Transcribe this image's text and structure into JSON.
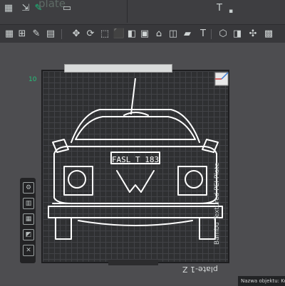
{
  "title_bar": {
    "plate_ghost": "plate",
    "t_icon": "T"
  },
  "toolbar": {
    "icons": [
      "grid-icon",
      "move-icon",
      "rotate-icon",
      "scale-icon",
      "cube-icon",
      "split-icon",
      "cut-icon",
      "paint-icon",
      "text-icon",
      "assemble-icon",
      "arrange-icon",
      "support-icon"
    ]
  },
  "plate": {
    "texture_label": "Bambu Textured PEI Plate",
    "name": "plate-1",
    "name_suffix": "Z",
    "origin_label": "10",
    "model_sign": "FASL T 183"
  },
  "status": {
    "text": "Nazwa objektu: Keyc"
  },
  "colors": {
    "accent": "#16c07a",
    "model_lines": "#ffffff",
    "plate_bg": "#2f3032"
  }
}
